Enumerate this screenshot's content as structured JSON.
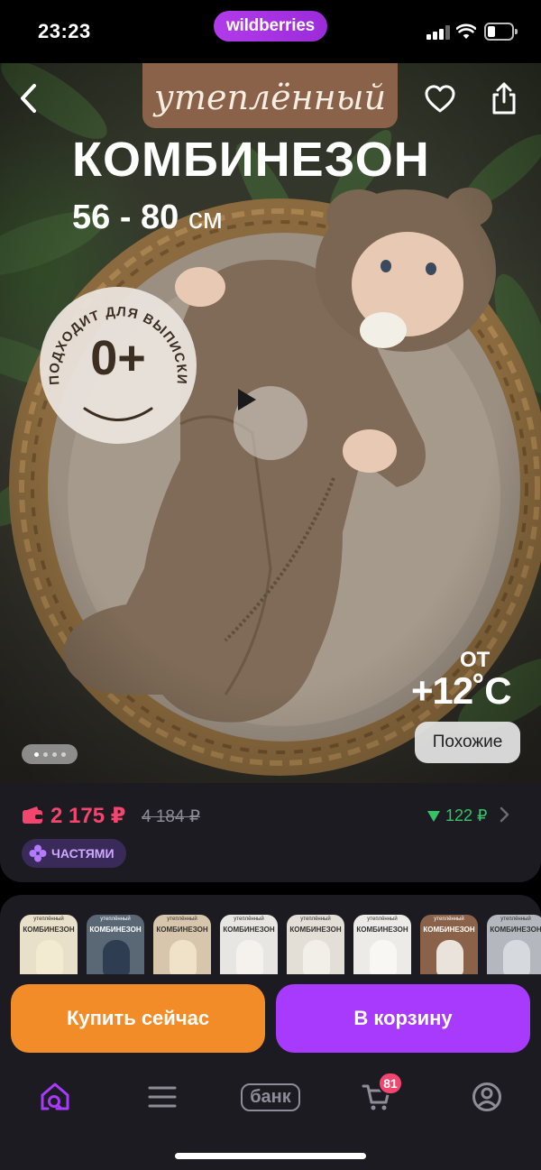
{
  "status_bar": {
    "time": "23:23",
    "brand": "wildberries"
  },
  "hero": {
    "label_warm": "утеплённый",
    "title": "КОМБИНЕЗОН",
    "size_range": "56 - 80",
    "size_unit": "см",
    "badge_arc_text": "ПОДХОДИТ ДЛЯ ВЫПИСКИ",
    "badge_age": "0+",
    "temp_prefix": "ОТ",
    "temp_value": "+12˚C",
    "similar_label": "Похожие",
    "image_count": 4,
    "active_image_index": 0
  },
  "price": {
    "current": "2 175 ₽",
    "old": "4 184 ₽",
    "cashback": "122 ₽",
    "parts_label": "ЧАСТЯМИ"
  },
  "variants": [
    {
      "label": "утеплённый",
      "title": "КОМБИНЕЗОН",
      "bg": "#e9e0c9",
      "text": "#333",
      "baby": "#f3ead2"
    },
    {
      "label": "утеплённый",
      "title": "КОМБИНЕЗОН",
      "bg": "#5a6775",
      "text": "#fff",
      "baby": "#2e3d52"
    },
    {
      "label": "утеплённый",
      "title": "КОМБИНЕЗОН",
      "bg": "#d8c6ac",
      "text": "#333",
      "baby": "#efe2c8"
    },
    {
      "label": "утеплённый",
      "title": "КОМБИНЕЗОН",
      "bg": "#e8e6e2",
      "text": "#333",
      "baby": "#f5f2ed"
    },
    {
      "label": "утеплённый",
      "title": "КОМБИНЕЗОН",
      "bg": "#e3ded6",
      "text": "#333",
      "baby": "#f2eee8"
    },
    {
      "label": "утеплённый",
      "title": "КОМБИНЕЗОН",
      "bg": "#ecebe8",
      "text": "#333",
      "baby": "#f8f7f4"
    },
    {
      "label": "утеплённый",
      "title": "КОМБИНЕЗОН",
      "bg": "#8a6249",
      "text": "#fff",
      "baby": "#e9e3dc"
    },
    {
      "label": "утеплённый",
      "title": "КОМБИНЕЗОН",
      "bg": "#b4b7bd",
      "text": "#333",
      "baby": "#d6d9de"
    }
  ],
  "actions": {
    "buy_now": "Купить сейчас",
    "to_cart": "В корзину"
  },
  "nav": {
    "bank_label": "банк",
    "cart_count": "81"
  },
  "colors": {
    "accent_purple": "#a73afd",
    "accent_orange": "#f28c28",
    "price_red": "#f2466f",
    "cashback_green": "#35c36a",
    "panel_bg": "#1c1b22"
  }
}
